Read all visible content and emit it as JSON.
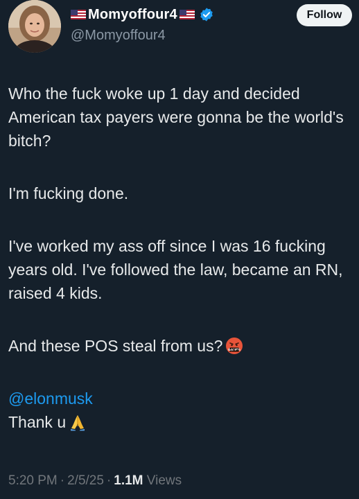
{
  "author": {
    "display_name": "Momyoffour4",
    "handle": "@Momyoffour4",
    "verified": true,
    "left_flag": "us-flag-icon",
    "right_flag": "us-flag-icon"
  },
  "follow_label": "Follow",
  "tweet": {
    "p1": "Who the fuck woke up 1 day and decided American tax payers were gonna be the world's bitch?",
    "p2": "I'm fucking done.",
    "p3": "I've worked my ass off since I was 16 fucking years old. I've followed the law, became an RN, raised 4 kids.",
    "p4": "And these POS steal from us?",
    "p4_emoji": "cursing-face-icon",
    "mention": "@elonmusk",
    "closing": "Thank u",
    "closing_emoji": "folded-hands-icon"
  },
  "meta": {
    "time": "5:20 PM",
    "date": "2/5/25",
    "views_count": "1.1M",
    "views_label": "Views",
    "separator": "·"
  },
  "colors": {
    "background": "#15202b",
    "mention": "#1d9bf0",
    "verified": "#1d9bf0",
    "muted": "#71767b"
  }
}
